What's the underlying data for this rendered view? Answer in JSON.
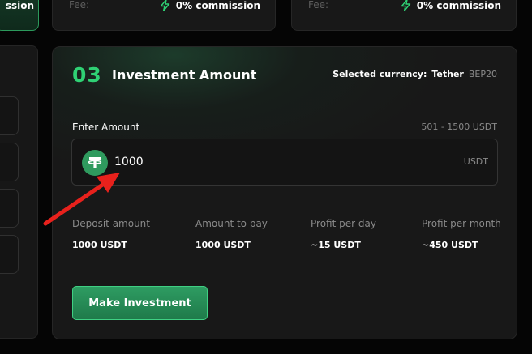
{
  "top_cards": {
    "left_label": "ssion",
    "cards": [
      {
        "fee_label": "Fee:",
        "commission": "0% commission",
        "icon": "bolt-icon"
      },
      {
        "fee_label": "Fee:",
        "commission": "0% commission",
        "icon": "bolt-icon"
      }
    ]
  },
  "section": {
    "step_number": "03",
    "title": "Investment Amount",
    "currency_label": "Selected currency:",
    "currency_name": "Tether",
    "currency_network": "BEP20"
  },
  "amount": {
    "label": "Enter Amount",
    "range": "501 - 1500 USDT",
    "value": "1000",
    "unit": "USDT",
    "coin_icon": "tether-icon"
  },
  "stats": [
    {
      "label": "Deposit amount",
      "value": "1000 USDT"
    },
    {
      "label": "Amount to pay",
      "value": "1000 USDT"
    },
    {
      "label": "Profit per day",
      "value": "~15 USDT"
    },
    {
      "label": "Profit per month",
      "value": "~450 USDT"
    }
  ],
  "button": {
    "label": "Make Investment"
  },
  "colors": {
    "accent": "#2fd174",
    "button": "#2e9c62",
    "annotation_arrow": "#e8211c",
    "background": "#050505",
    "panel": "#181818"
  }
}
